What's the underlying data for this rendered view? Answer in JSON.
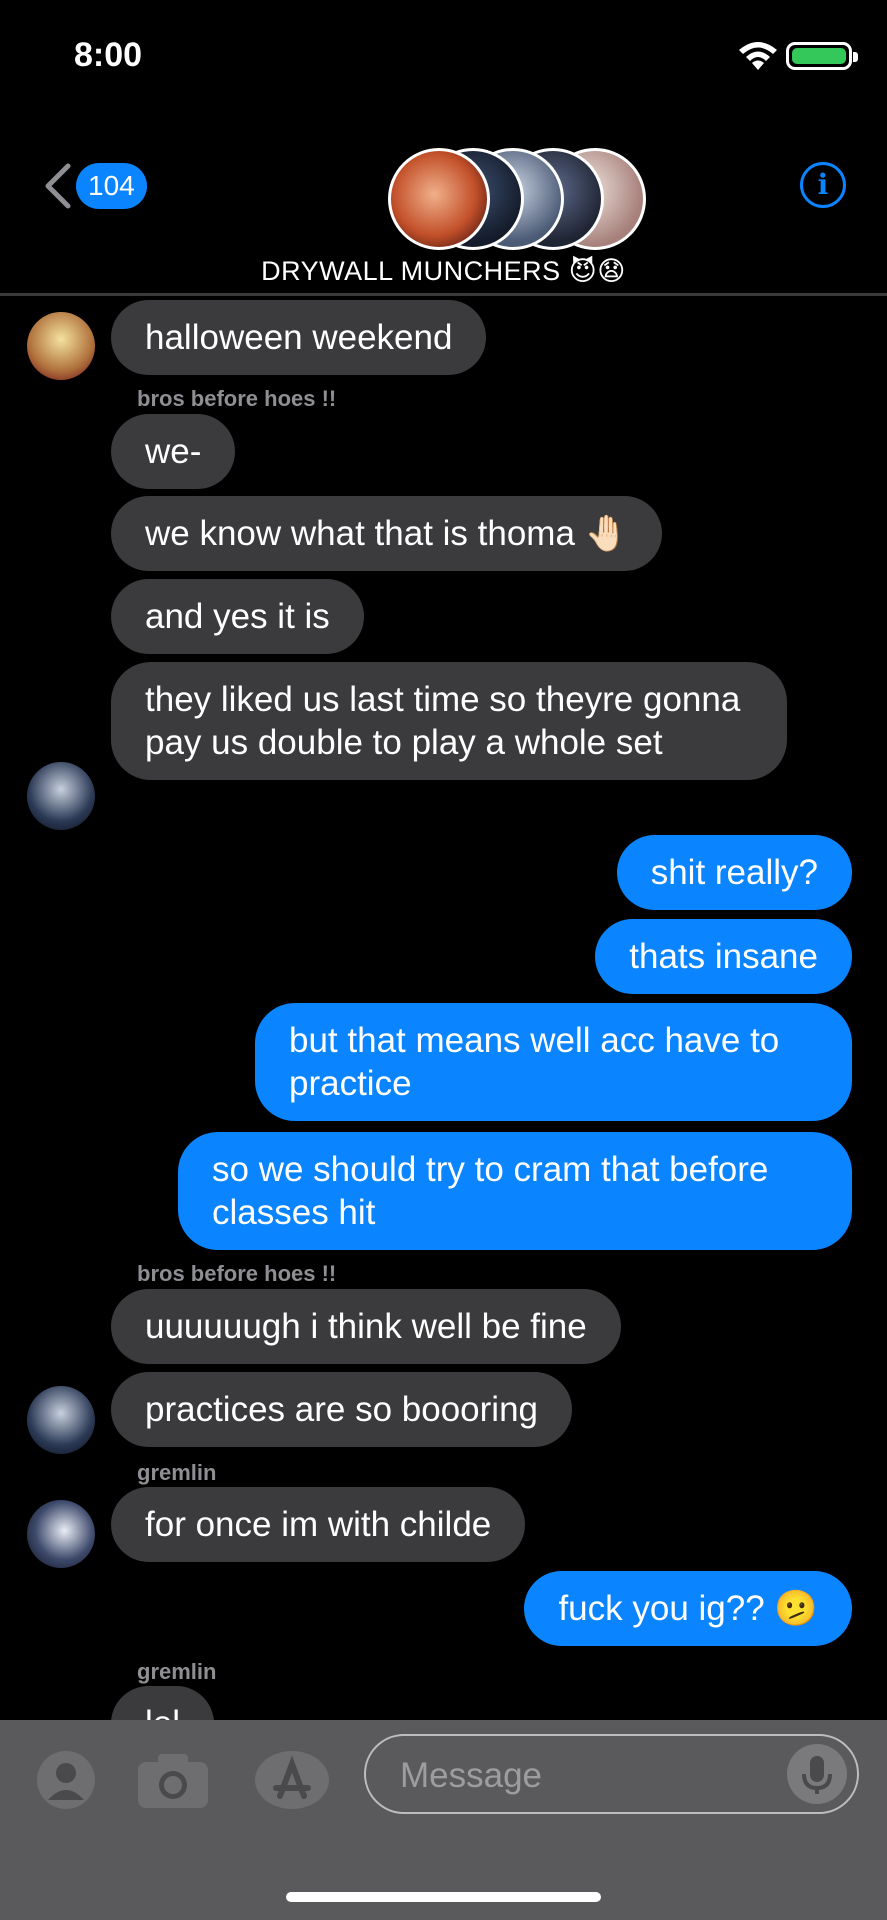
{
  "status_bar": {
    "time": "8:00"
  },
  "nav": {
    "back_badge": "104",
    "group_name": "DRYWALL MUNCHERS 😈😧",
    "info_label": "i"
  },
  "messages": [
    {
      "side": "in",
      "text": "halloween weekend"
    },
    {
      "sender": "bros before hoes !!"
    },
    {
      "side": "in",
      "text": "we-"
    },
    {
      "side": "in",
      "text": "we know what that is thoma 🤚🏻"
    },
    {
      "side": "in",
      "text": "and yes it is"
    },
    {
      "side": "in",
      "text": "they liked us last time so theyre gonna pay us double to play a whole set"
    },
    {
      "side": "out",
      "text": "shit really?"
    },
    {
      "side": "out",
      "text": "thats insane"
    },
    {
      "side": "out",
      "text": "but that means well acc have to practice"
    },
    {
      "side": "out",
      "text": "so we should try to cram that before classes hit"
    },
    {
      "sender": "bros before hoes !!"
    },
    {
      "side": "in",
      "text": "uuuuuugh i think well be fine"
    },
    {
      "side": "in",
      "text": "practices are so boooring"
    },
    {
      "sender": "gremlin"
    },
    {
      "side": "in",
      "text": "for once im with childe"
    },
    {
      "side": "out",
      "text": "fuck you ig?? 🫤"
    },
    {
      "sender": "gremlin"
    },
    {
      "side": "in",
      "text": "lol"
    }
  ],
  "input": {
    "placeholder": "Message"
  },
  "colors": {
    "accent": "#0a84ff",
    "incoming_bubble": "#3b3b3d",
    "background": "#000000",
    "battery": "#34c759"
  },
  "icons": [
    "wifi-icon",
    "battery-icon",
    "chevron-left-icon",
    "info-icon",
    "contact-icon",
    "camera-icon",
    "app-store-icon",
    "microphone-icon"
  ]
}
